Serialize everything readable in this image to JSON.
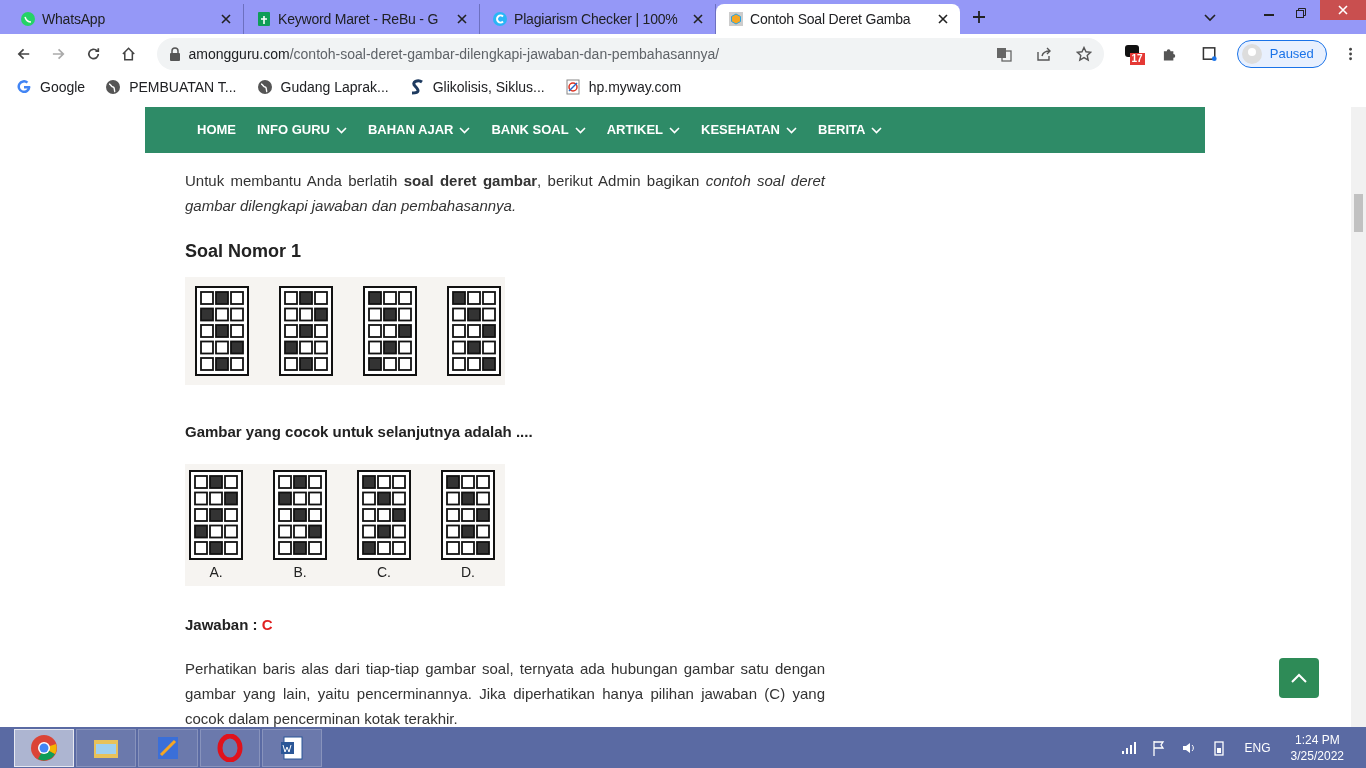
{
  "tabs": [
    {
      "title": "WhatsApp",
      "selected": false
    },
    {
      "title": "Keyword Maret - ReBu - G",
      "selected": false
    },
    {
      "title": "Plagiarism Checker | 100%",
      "selected": false
    },
    {
      "title": "Contoh Soal Deret Gamba",
      "selected": true
    }
  ],
  "address": {
    "domain": "amongguru.com",
    "path": "/contoh-soal-deret-gambar-dilengkapi-jawaban-dan-pembahasannya/"
  },
  "extension_badge": "17",
  "profile": "Paused",
  "bookmarks": [
    {
      "label": "Google"
    },
    {
      "label": "PEMBUATAN T..."
    },
    {
      "label": "Gudang Laprak..."
    },
    {
      "label": "Glikolisis, Siklus..."
    },
    {
      "label": "hp.myway.com"
    }
  ],
  "nav": [
    {
      "label": "HOME",
      "dropdown": false
    },
    {
      "label": "INFO GURU",
      "dropdown": true
    },
    {
      "label": "BAHAN AJAR",
      "dropdown": true
    },
    {
      "label": "BANK SOAL",
      "dropdown": true
    },
    {
      "label": "ARTIKEL",
      "dropdown": true
    },
    {
      "label": "KESEHATAN",
      "dropdown": true
    },
    {
      "label": "BERITA",
      "dropdown": true
    }
  ],
  "intro": "Untuk membantu Anda berlatih **soal deret gambar**, berikut Admin bagikan *contoh soal deret gambar dilengkapi jawaban dan pembahasannya.*",
  "heading": "Soal Nomor 1",
  "question_figures": [
    {
      "cells": [
        [
          false,
          true,
          false
        ],
        [
          true,
          false,
          false
        ],
        [
          false,
          true,
          false
        ],
        [
          false,
          false,
          true
        ],
        [
          false,
          true,
          false
        ]
      ]
    },
    {
      "cells": [
        [
          false,
          true,
          false
        ],
        [
          false,
          false,
          true
        ],
        [
          false,
          true,
          false
        ],
        [
          true,
          false,
          false
        ],
        [
          false,
          true,
          false
        ]
      ]
    },
    {
      "cells": [
        [
          true,
          false,
          false
        ],
        [
          false,
          true,
          false
        ],
        [
          false,
          false,
          true
        ],
        [
          false,
          true,
          false
        ],
        [
          true,
          false,
          false
        ]
      ]
    },
    {
      "cells": [
        [
          true,
          false,
          false
        ],
        [
          false,
          true,
          false
        ],
        [
          false,
          false,
          true
        ],
        [
          false,
          true,
          false
        ],
        [
          false,
          false,
          true
        ]
      ]
    }
  ],
  "prompt": "Gambar yang cocok untuk selanjutnya adalah ....",
  "options": [
    {
      "label": "A.",
      "cells": [
        [
          false,
          true,
          false
        ],
        [
          false,
          false,
          true
        ],
        [
          false,
          true,
          false
        ],
        [
          true,
          false,
          false
        ],
        [
          false,
          true,
          false
        ]
      ]
    },
    {
      "label": "B.",
      "cells": [
        [
          false,
          true,
          false
        ],
        [
          true,
          false,
          false
        ],
        [
          false,
          true,
          false
        ],
        [
          false,
          false,
          true
        ],
        [
          false,
          true,
          false
        ]
      ]
    },
    {
      "label": "C.",
      "cells": [
        [
          true,
          false,
          false
        ],
        [
          false,
          true,
          false
        ],
        [
          false,
          false,
          true
        ],
        [
          false,
          true,
          false
        ],
        [
          true,
          false,
          false
        ]
      ]
    },
    {
      "label": "D.",
      "cells": [
        [
          true,
          false,
          false
        ],
        [
          false,
          true,
          false
        ],
        [
          false,
          false,
          true
        ],
        [
          false,
          true,
          false
        ],
        [
          false,
          false,
          true
        ]
      ]
    }
  ],
  "answer": {
    "label": "Jawaban :",
    "value": "C"
  },
  "explanation": "Perhatikan baris alas dari tiap-tiap gambar soal, ternyata ada hubungan gambar satu dengan gambar yang lain, yaitu pencerminannya. Jika diperhatikan hanya pilihan jawaban (C) yang cocok dalam pencerminan kotak terakhir.",
  "taskbar": [
    {
      "active": true
    },
    {
      "active": false
    },
    {
      "active": false
    },
    {
      "active": false
    },
    {
      "active": false
    }
  ],
  "tray": {
    "language": "ENG",
    "time": "1:24 PM",
    "date": "3/25/2022"
  }
}
